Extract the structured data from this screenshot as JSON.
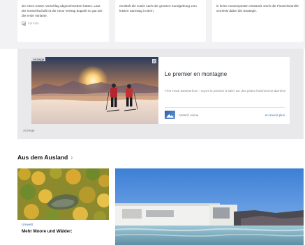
{
  "top_cards": [
    {
      "text": "sie einen ersten Vorschlag abgeschmettert hatten. Laut der Gewerkschaft ist der neue Vertrag doppelt so gut wie die erste Variante.",
      "photo_label": "mit Foto"
    },
    {
      "text": "ermittelt die Justiz nach der grossen Kundgebung vom letzten Samstag in Bern.",
      "photo_label": ""
    },
    {
      "text": "in keine Aussenposten entsandt. Doch die Finanzkontrolle vermisst dabei die Strategie.",
      "photo_label": ""
    }
  ],
  "ad": {
    "badge": "Anzeige",
    "title": "Le premier en montagne",
    "description": "First Track Bettmerhorn : soyez le premier à skier sur des pistes fraîchement damées",
    "brand": "Aletsch Arena",
    "cta": "en savoir plus",
    "label": "Anzeige"
  },
  "section": {
    "heading": "Aus dem Ausland",
    "chevron": "›"
  },
  "stories": [
    {
      "kicker": "Umwelt",
      "title": "Mehr Moore und Wälder:"
    }
  ],
  "colors": {
    "accent": "#2f6fc4",
    "background_band": "#f2f2f4"
  }
}
